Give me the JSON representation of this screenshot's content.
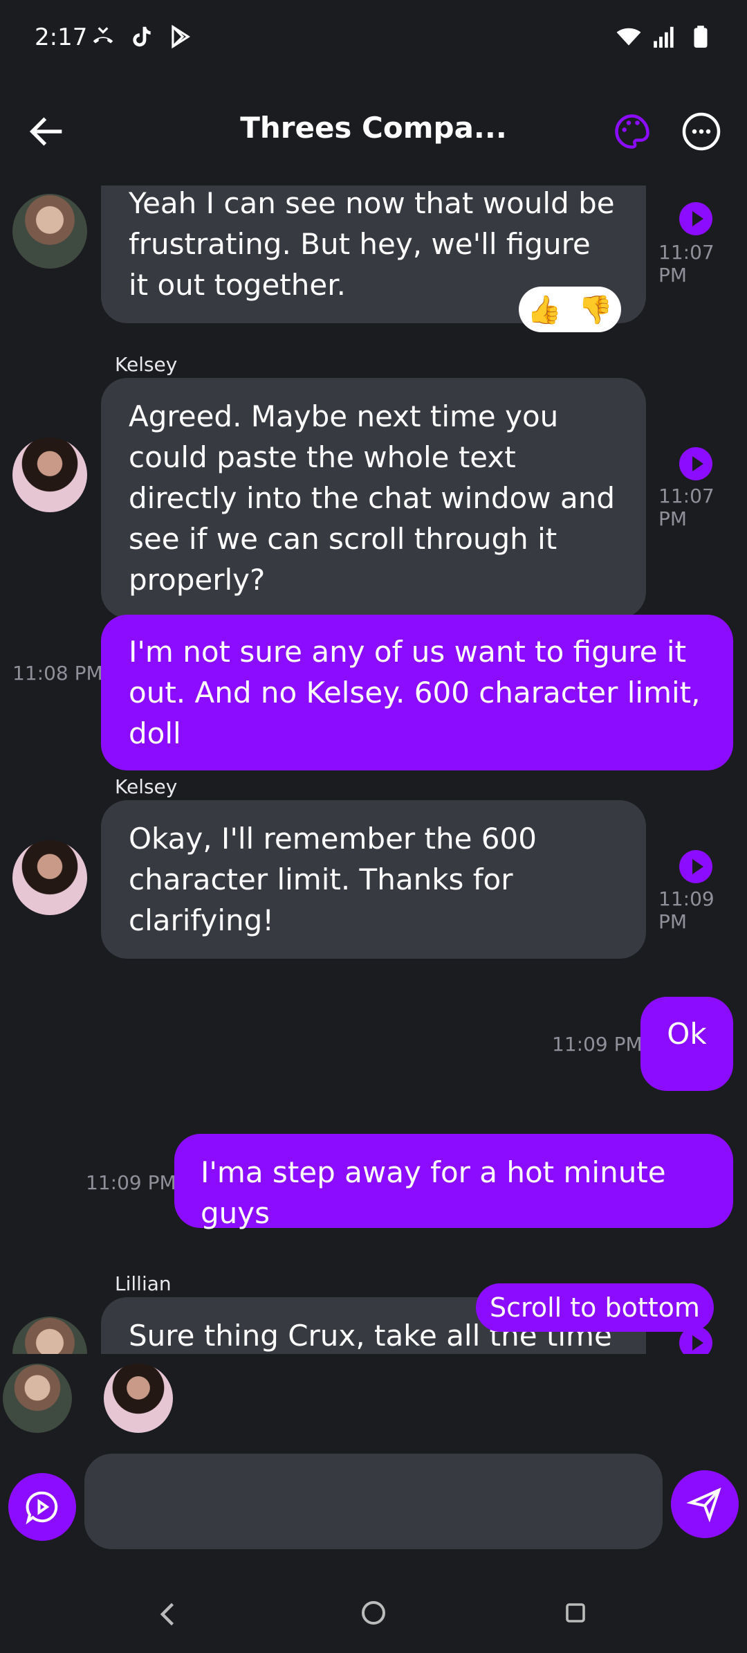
{
  "status_bar": {
    "time": "2:17"
  },
  "header": {
    "title": "Threes Compa..."
  },
  "messages": [
    {
      "text": "Yeah I can see now that would be frustrating. But hey, we'll figure it out together.",
      "time": "11:07 PM"
    },
    {
      "sender": "Kelsey",
      "text": "Agreed. Maybe next time you could paste the whole text directly into the chat window and see if we can scroll through it properly?",
      "time": "11:07 PM"
    },
    {
      "text": "I'm not sure any of us want to figure it out. And no Kelsey. 600 character limit, doll",
      "time": "11:08 PM"
    },
    {
      "sender": "Kelsey",
      "text": "Okay, I'll remember the 600 character limit. Thanks for clarifying!",
      "time": "11:09 PM"
    },
    {
      "text": "Ok",
      "time": "11:09 PM"
    },
    {
      "text": "I'ma step away for a hot minute guys",
      "time": "11:09 PM"
    },
    {
      "sender": "Lillian",
      "text": "Sure thing Crux, take all the time"
    }
  ],
  "reactions": {
    "like": "👍",
    "dislike": "👎"
  },
  "scroll_button": "Scroll to bottom",
  "colors": {
    "accent": "#8c0cff",
    "background": "#1b1c20",
    "bubble_incoming": "#383a41"
  }
}
